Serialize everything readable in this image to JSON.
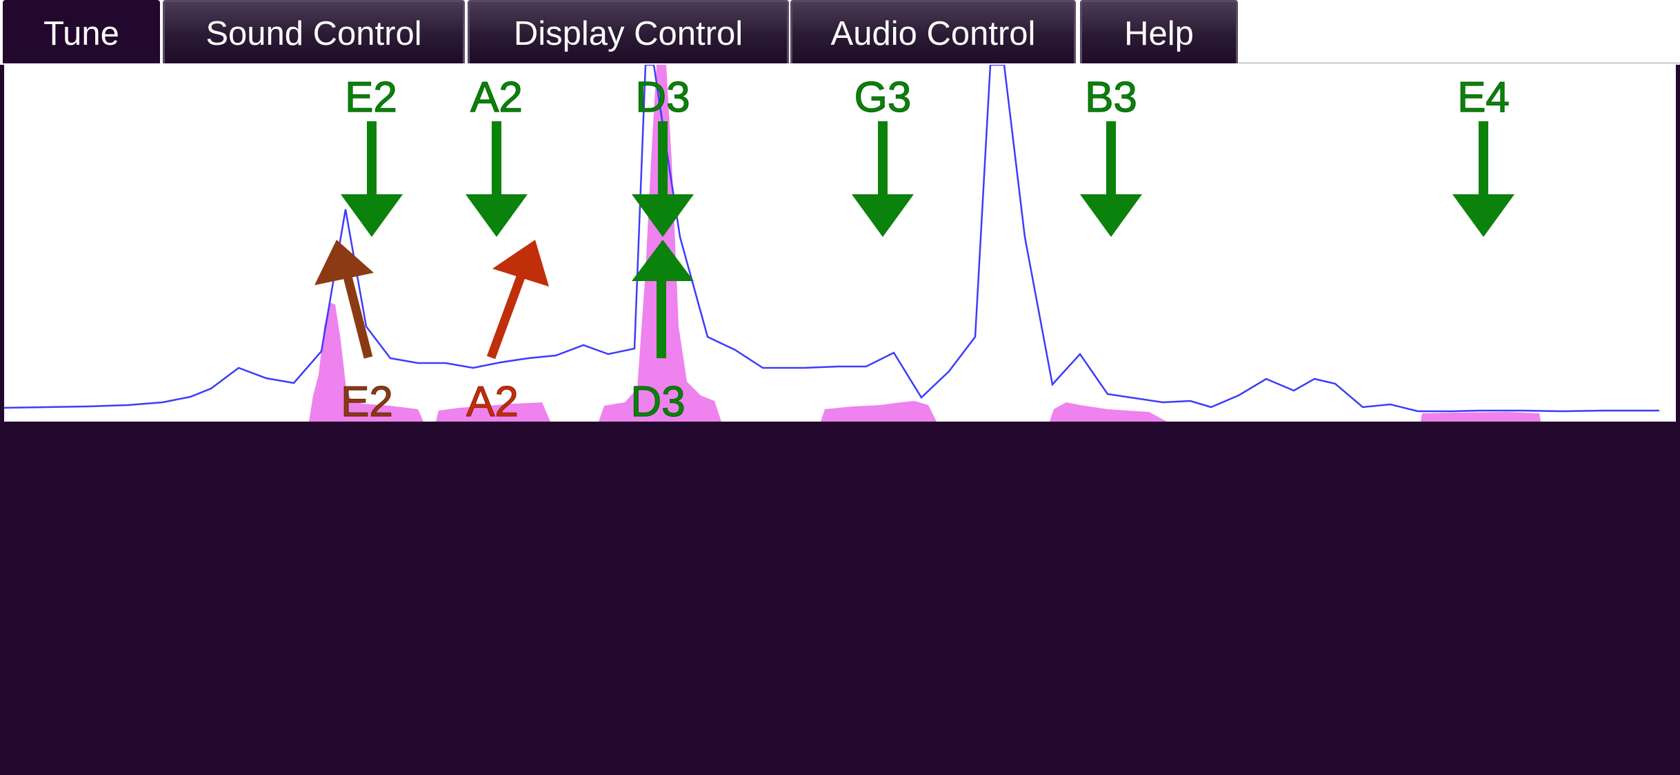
{
  "tabs": [
    {
      "label": "Tune",
      "active": true
    },
    {
      "label": "Sound Control",
      "active": false
    },
    {
      "label": "Display Control",
      "active": false
    },
    {
      "label": "Audio Control",
      "active": false
    },
    {
      "label": "Help",
      "active": false
    }
  ],
  "tuner": {
    "strings": [
      {
        "note": "E2",
        "detected": true,
        "detected_color": "#8b3a14"
      },
      {
        "note": "A2",
        "detected": true,
        "detected_color": "#c02e0a"
      },
      {
        "note": "D3",
        "detected": true,
        "detected_color": "#0b820b"
      },
      {
        "note": "G3",
        "detected": false
      },
      {
        "note": "B3",
        "detected": false
      },
      {
        "note": "E4",
        "detected": false
      }
    ],
    "colors": {
      "target": "#0b820b",
      "spectrum_line": "#3b3bff",
      "spectrum_fill": "#ee82ee",
      "background": "#ffffff",
      "panel": "#22082c"
    }
  }
}
